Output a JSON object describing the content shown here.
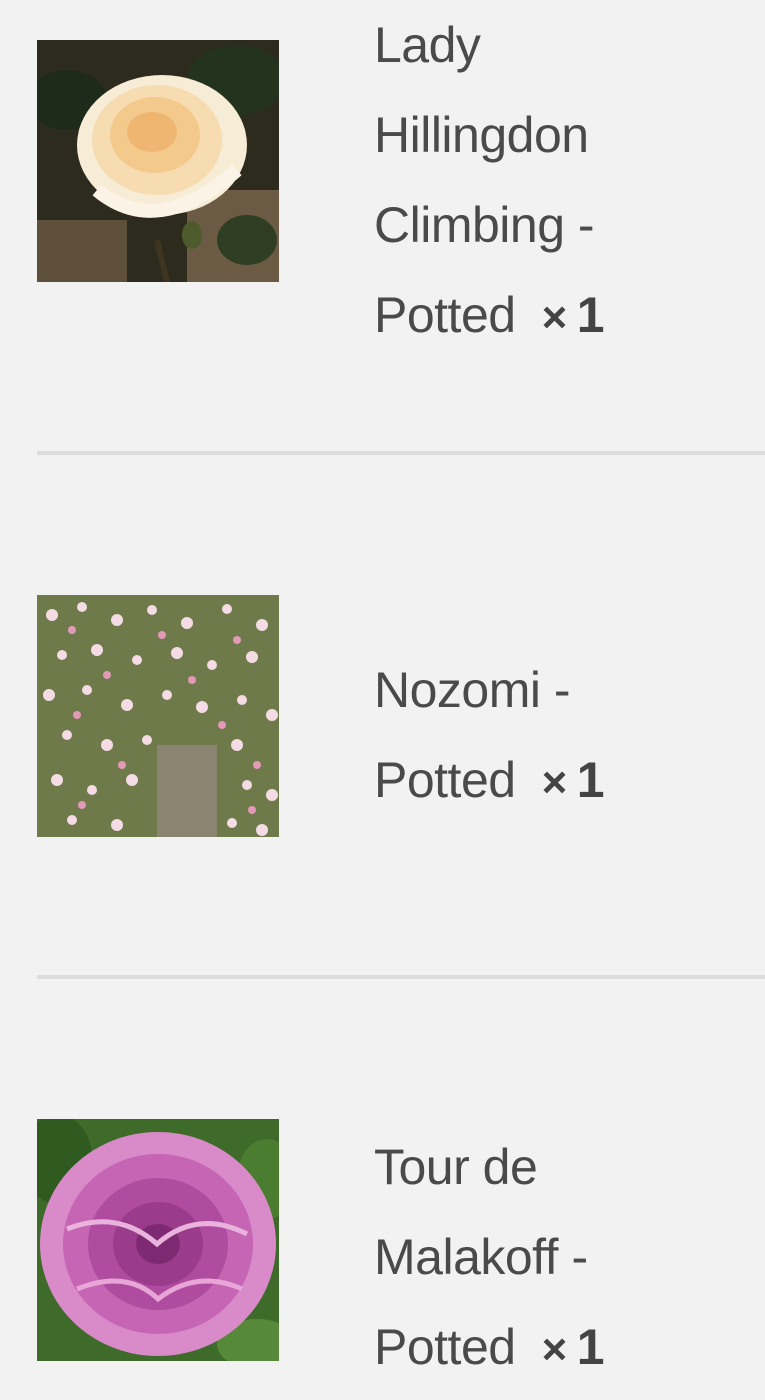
{
  "cart": {
    "quantity_prefix": "×",
    "items": [
      {
        "name": "Lady Hillingdon Climbing - Potted",
        "quantity": "1",
        "image": "rose-peach-icon"
      },
      {
        "name": "Nozomi - Potted",
        "quantity": "1",
        "image": "rose-pink-shrub-icon"
      },
      {
        "name": "Tour de Malakoff - Potted",
        "quantity": "1",
        "image": "rose-magenta-icon"
      }
    ]
  },
  "colors": {
    "background": "#f2f2f2",
    "text": "#4a4a4a",
    "divider": "#dcdcdc"
  }
}
